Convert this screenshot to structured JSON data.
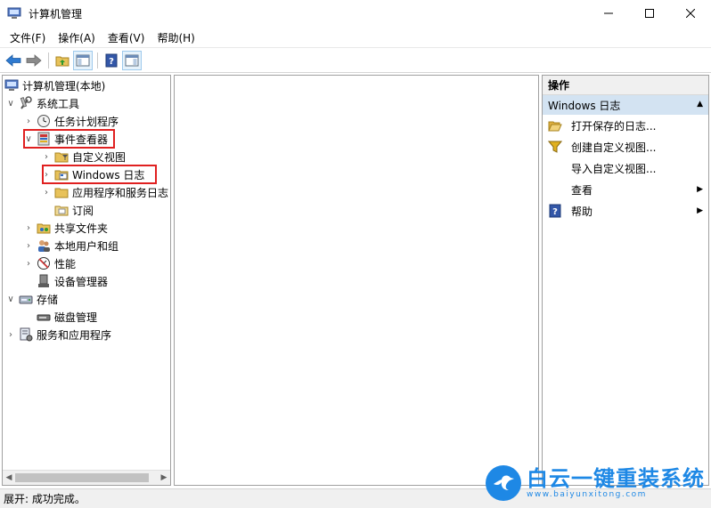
{
  "window": {
    "title": "计算机管理",
    "controls": [
      "minimize-icon",
      "maximize-icon",
      "close-icon"
    ]
  },
  "menu": [
    "文件(F)",
    "操作(A)",
    "查看(V)",
    "帮助(H)"
  ],
  "toolbar": [
    "back-arrow-icon",
    "forward-arrow-icon",
    "up-folder-icon",
    "show-tree-icon",
    "help-icon",
    "show-action-pane-icon"
  ],
  "tree": [
    {
      "label": "计算机管理(本地)",
      "icon": "computer-management-icon"
    },
    {
      "label": "系统工具",
      "icon": "system-tools-icon"
    },
    {
      "label": "任务计划程序",
      "icon": "clock-icon"
    },
    {
      "label": "事件查看器",
      "icon": "event-viewer-icon"
    },
    {
      "label": "自定义视图",
      "icon": "folder-filter-icon"
    },
    {
      "label": "Windows 日志",
      "icon": "windows-logs-icon"
    },
    {
      "label": "应用程序和服务日志",
      "icon": "folder-icon"
    },
    {
      "label": "订阅",
      "icon": "subscription-icon"
    },
    {
      "label": "共享文件夹",
      "icon": "shared-folder-icon"
    },
    {
      "label": "本地用户和组",
      "icon": "users-icon"
    },
    {
      "label": "性能",
      "icon": "performance-icon"
    },
    {
      "label": "设备管理器",
      "icon": "device-manager-icon"
    },
    {
      "label": "存储",
      "icon": "storage-icon"
    },
    {
      "label": "磁盘管理",
      "icon": "disk-icon"
    },
    {
      "label": "服务和应用程序",
      "icon": "services-icon"
    }
  ],
  "actions": {
    "header": "操作",
    "section": "Windows 日志",
    "items": [
      {
        "label": "打开保存的日志...",
        "icon": "open-folder-icon"
      },
      {
        "label": "创建自定义视图...",
        "icon": "filter-icon"
      },
      {
        "label": "导入自定义视图...",
        "icon": ""
      },
      {
        "label": "查看",
        "icon": ""
      },
      {
        "label": "帮助",
        "icon": "help-icon"
      }
    ]
  },
  "status": "展开: 成功完成。",
  "watermark": {
    "text": "白云一键重装系统",
    "url": "www.baiyunxitong.com"
  },
  "colors": {
    "selection_section": "#d3e3f2",
    "highlight_border": "#e02020",
    "brand_blue": "#1e88e5"
  }
}
